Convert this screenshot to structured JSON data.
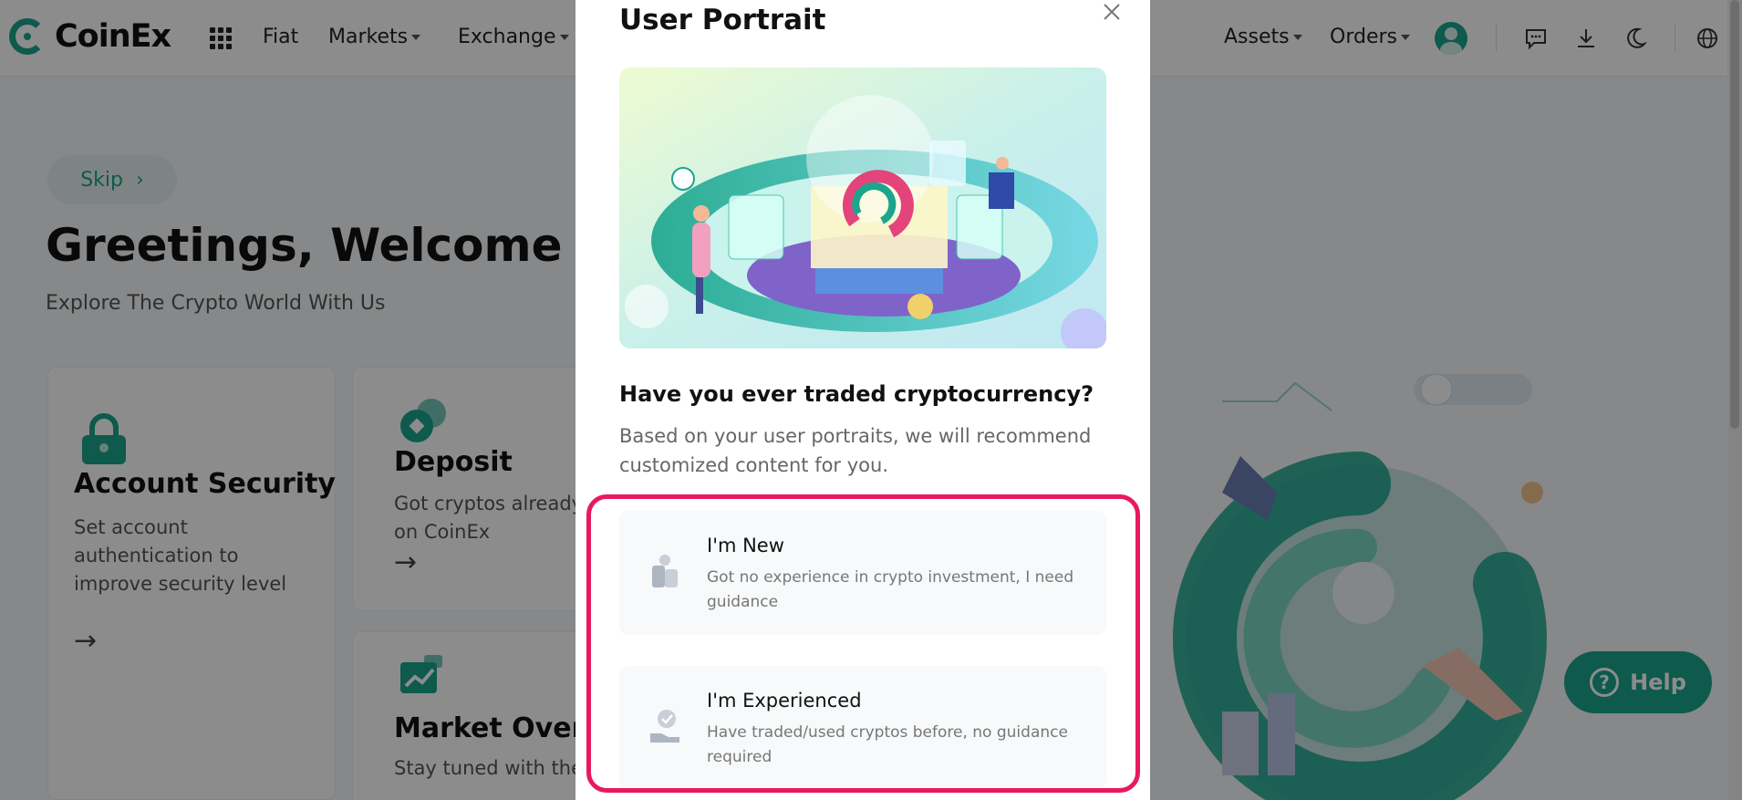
{
  "brand": {
    "name": "CoinEx",
    "accent": "#1aa58c"
  },
  "nav": {
    "fiat": "Fiat",
    "markets": "Markets",
    "exchange": "Exchange",
    "assets": "Assets",
    "orders": "Orders"
  },
  "page": {
    "skip_label": "Skip",
    "greeting": "Greetings, Welcome To C",
    "subtitle": "Explore The Crypto World With Us"
  },
  "cards": {
    "security": {
      "title": "Account Security",
      "desc": "Set account authentication to improve security level"
    },
    "deposit": {
      "title": "Deposit",
      "desc_line1": "Got cryptos already.",
      "desc_line2": "on CoinEx"
    },
    "market": {
      "title": "Market Overvi",
      "desc": "Stay tuned with the"
    }
  },
  "help": {
    "label": "Help"
  },
  "modal": {
    "title": "User Portrait",
    "question": "Have you ever traded cryptocurrency?",
    "explain": "Based on your user portraits, we will recommend customized content for you.",
    "highlight_color": "#e8195f",
    "options": [
      {
        "title": "I'm New",
        "desc": "Got no experience in crypto investment, I need guidance"
      },
      {
        "title": "I'm Experienced",
        "desc": "Have traded/used cryptos before, no guidance required"
      }
    ]
  }
}
